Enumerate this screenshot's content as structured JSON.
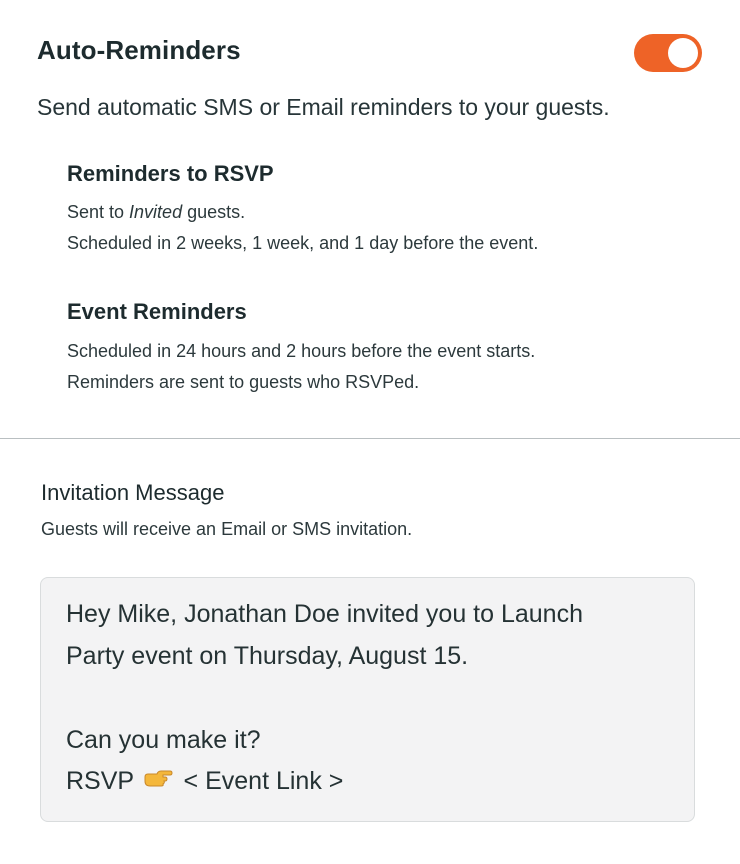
{
  "auto_reminders": {
    "title": "Auto-Reminders",
    "toggle_on": true,
    "description": "Send automatic SMS or Email reminders to your guests."
  },
  "rsvp_reminders": {
    "title": "Reminders to RSVP",
    "line1_prefix": "Sent to ",
    "line1_emphasis": "Invited",
    "line1_suffix": " guests.",
    "line2": "Scheduled in 2 weeks, 1 week, and 1 day before the event."
  },
  "event_reminders": {
    "title": "Event Reminders",
    "line1": "Scheduled in 24 hours and 2 hours before the event starts.",
    "line2": "Reminders are sent to guests who RSVPed."
  },
  "invitation": {
    "title": "Invitation Message",
    "description": "Guests will receive an Email or SMS invitation.",
    "message": {
      "line1": "Hey Mike, Jonathan Doe invited you to Launch",
      "line2": "Party event on Thursday, August 15.",
      "line3": "Can you make it?",
      "line4_prefix": "RSVP",
      "line4_suffix": "< Event Link >",
      "icon": "pointing-hand-icon"
    }
  },
  "colors": {
    "toggle_accent": "#ee6327",
    "text_primary": "#1d2b2e",
    "message_background": "#f3f3f4"
  }
}
